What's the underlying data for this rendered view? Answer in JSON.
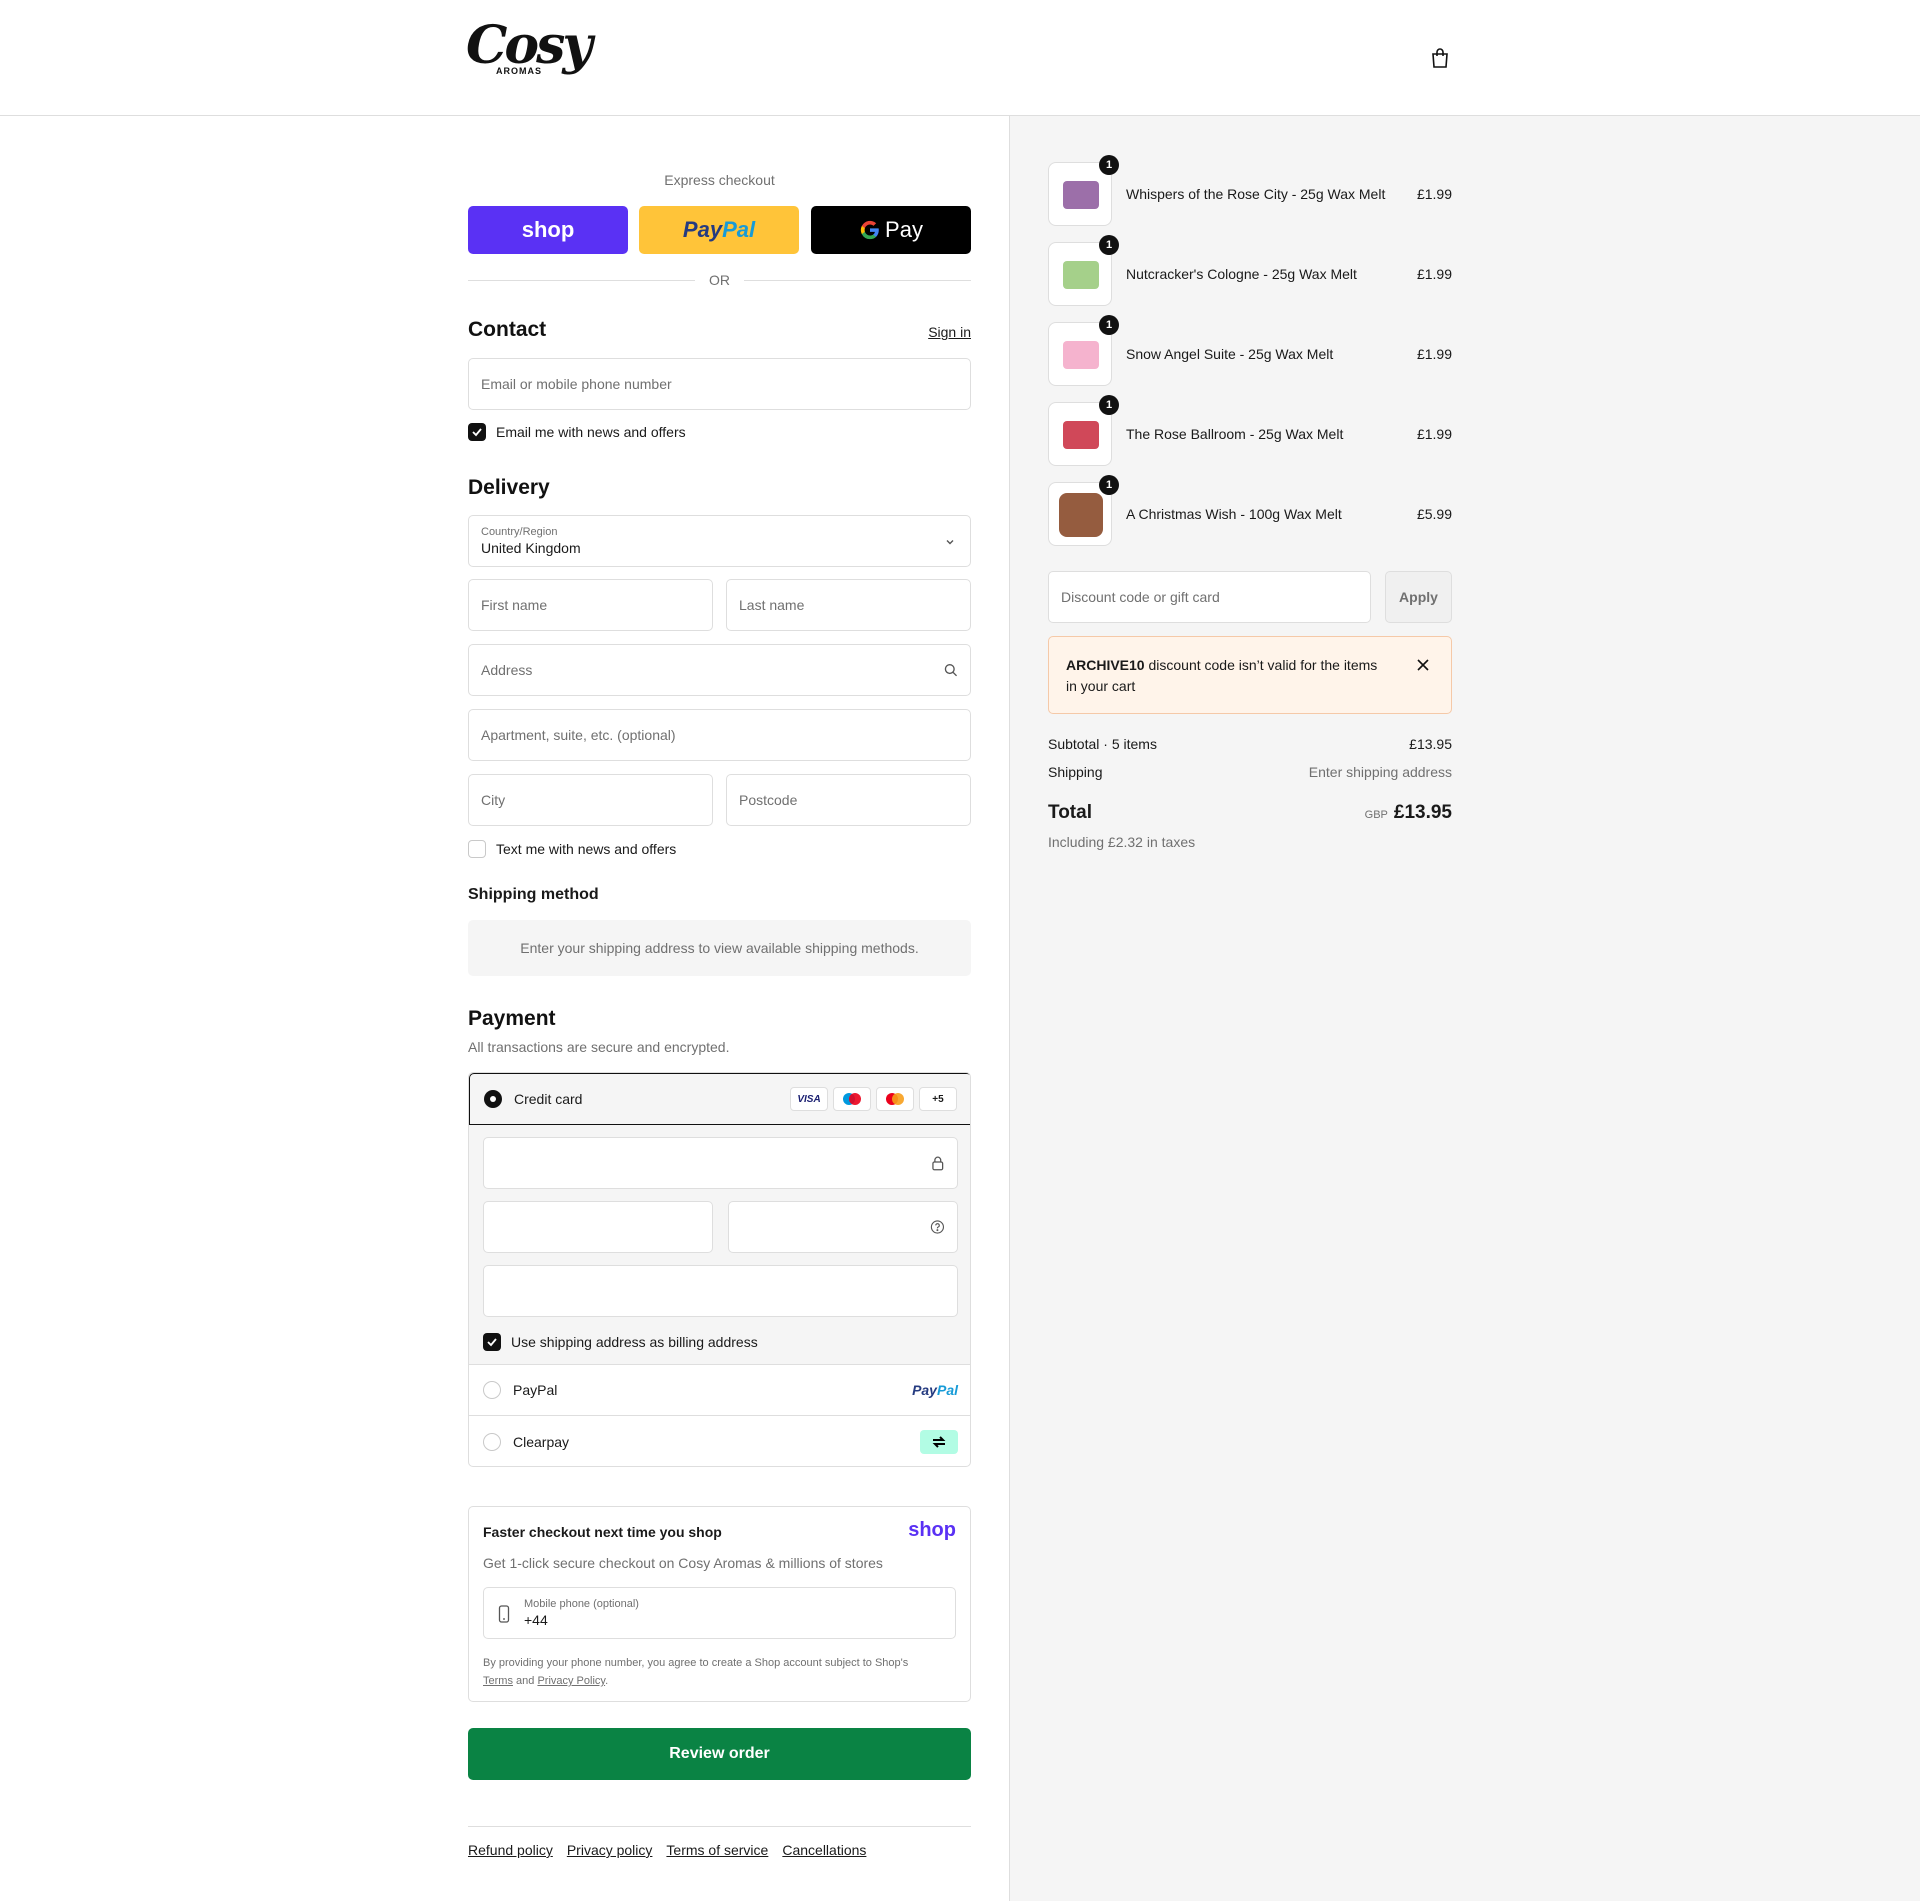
{
  "header": {
    "logo_text": "Cosy",
    "logo_sub": "AROMAS",
    "cart_icon": "shopping-bag-icon"
  },
  "express": {
    "title": "Express checkout",
    "shop_label": "shop",
    "paypal_label_pay": "Pay",
    "paypal_label_pal": "Pal",
    "gpay_label": "Pay",
    "or_label": "OR"
  },
  "contact": {
    "title": "Contact",
    "sign_in": "Sign in",
    "email_placeholder": "Email or mobile phone number",
    "news_label": "Email me with news and offers",
    "news_checked": true
  },
  "delivery": {
    "title": "Delivery",
    "country_label": "Country/Region",
    "country_value": "United Kingdom",
    "first_name_placeholder": "First name",
    "last_name_placeholder": "Last name",
    "address_placeholder": "Address",
    "apartment_placeholder": "Apartment, suite, etc. (optional)",
    "city_placeholder": "City",
    "postcode_placeholder": "Postcode",
    "text_label": "Text me with news and offers",
    "text_checked": false
  },
  "shipping_method": {
    "title": "Shipping method",
    "message": "Enter your shipping address to view available shipping methods."
  },
  "payment": {
    "title": "Payment",
    "subtitle": "All transactions are secure and encrypted.",
    "credit_card_label": "Credit card",
    "card_brands": [
      "VISA",
      "Maestro",
      "Mastercard",
      "+5"
    ],
    "more_cards": "+5",
    "visa": "VISA",
    "billing_label": "Use shipping address as billing address",
    "billing_checked": true,
    "paypal_label": "PayPal",
    "paypal_logo_pay": "Pay",
    "paypal_logo_pal": "Pal",
    "clearpay_label": "Clearpay"
  },
  "shop_pay": {
    "title": "Faster checkout next time you shop",
    "logo": "shop",
    "subtitle": "Get 1-click secure checkout on Cosy Aromas & millions of stores",
    "phone_label": "Mobile phone (optional)",
    "phone_value": "+44",
    "legal_prefix": "By providing your phone number, you agree to create a Shop account subject to Shop's",
    "terms": "Terms",
    "and": "and",
    "privacy": "Privacy Policy",
    "period": "."
  },
  "review_button": "Review order",
  "footer_links": [
    "Refund policy",
    "Privacy policy",
    "Terms of service",
    "Cancellations"
  ],
  "cart": {
    "items": [
      {
        "name": "Whispers of the Rose City - 25g Wax Melt",
        "price": "£1.99",
        "qty": "1",
        "color": "#7b3f8c"
      },
      {
        "name": "Nutcracker's Cologne - 25g Wax Melt",
        "price": "£1.99",
        "qty": "1",
        "color": "#8fc46d"
      },
      {
        "name": "Snow Angel Suite - 25g Wax Melt",
        "price": "£1.99",
        "qty": "1",
        "color": "#f3a6c6"
      },
      {
        "name": "The Rose Ballroom - 25g Wax Melt",
        "price": "£1.99",
        "qty": "1",
        "color": "#c8283c"
      },
      {
        "name": "A Christmas Wish - 100g Wax Melt",
        "price": "£5.99",
        "qty": "1",
        "color": "#8a4a2a"
      }
    ],
    "discount_placeholder": "Discount code or gift card",
    "apply_label": "Apply",
    "error_code": "ARCHIVE10",
    "error_text": " discount code isn’t valid for the items in your cart",
    "subtotal_label": "Subtotal · 5 items",
    "subtotal_value": "£13.95",
    "shipping_label": "Shipping",
    "shipping_value": "Enter shipping address",
    "total_label": "Total",
    "currency": "GBP",
    "total_value": "£13.95",
    "tax_note": "Including £2.32 in taxes"
  },
  "colors": {
    "shop_purple": "#5a31f4",
    "paypal_yellow": "#ffc439",
    "review_green": "#0a8344",
    "warning_bg": "#fff4ea"
  }
}
